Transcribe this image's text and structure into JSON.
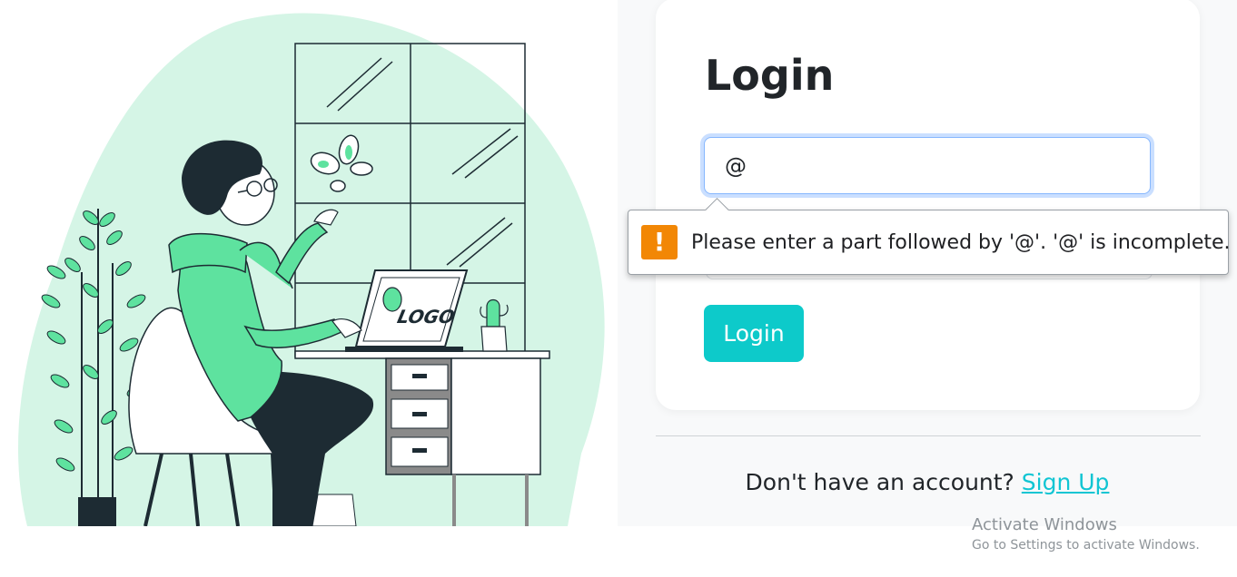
{
  "login": {
    "title": "Login",
    "email_value": "@",
    "submit_label": "Login"
  },
  "validation": {
    "message": "Please enter a part followed by '@'. '@' is incomplete.",
    "icon": "warning-icon",
    "icon_glyph": "!"
  },
  "signup": {
    "prompt": "Don't have an account?",
    "link_label": "Sign Up"
  },
  "watermark": {
    "title": "Activate Windows",
    "subtitle": "Go to Settings to activate Windows."
  },
  "illustration": {
    "laptop_logo_text": "LOGO"
  },
  "colors": {
    "accent": "#0dcaca",
    "link": "#11c5d3",
    "blob": "#d5f5e6",
    "hoodie": "#5ee29f",
    "dark": "#1d2b33",
    "warning": "#f28705"
  }
}
